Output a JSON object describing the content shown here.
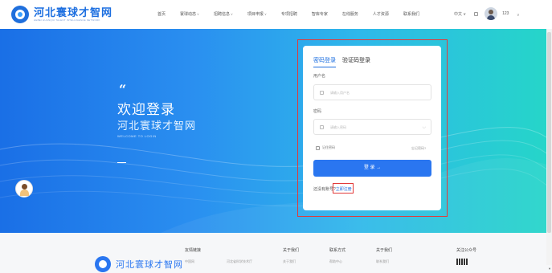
{
  "header": {
    "logo_name": "河北寰球才智网",
    "logo_sub": "HEBEI HUANQIU TALENT INTELLIGENCE NETWORK",
    "nav": [
      {
        "label": "首页",
        "has_menu": false
      },
      {
        "label": "寰球动态",
        "has_menu": true
      },
      {
        "label": "招聘信息",
        "has_menu": true
      },
      {
        "label": "项目申报",
        "has_menu": true
      },
      {
        "label": "专项招聘",
        "has_menu": false
      },
      {
        "label": "智库专家",
        "has_menu": false
      },
      {
        "label": "在线服务",
        "has_menu": false
      },
      {
        "label": "人才资源",
        "has_menu": false
      },
      {
        "label": "联系我们",
        "has_menu": false
      }
    ],
    "lang": "中文",
    "user_name": "123"
  },
  "hero": {
    "quote_mark": "“",
    "welcome": "欢迎登录",
    "site_name": "河北寰球才智网",
    "welcome_en": "WELCOME TO LOGIN"
  },
  "login": {
    "tabs": [
      {
        "label": "密码登录",
        "active": true
      },
      {
        "label": "验证码登录",
        "active": false
      }
    ],
    "username_label": "用户名",
    "username_placeholder": "请输入用户名",
    "password_label": "密码",
    "password_placeholder": "请输入密码",
    "remember_label": "记住密码",
    "forgot_label": "忘记密码?",
    "submit_label": "登 录",
    "register_prefix": "还没有账号?",
    "register_link": "立即注册"
  },
  "footer": {
    "logo_name": "河北寰球才智网",
    "columns": [
      {
        "title": "友情链接",
        "item": "中国网"
      },
      {
        "title": "关于我们",
        "item": "关于我们"
      },
      {
        "title": "联系方式",
        "item": "帮助中心"
      },
      {
        "title": "关于我们",
        "item": "联系我们"
      },
      {
        "title": "关注公众号",
        "item": ""
      }
    ],
    "extra_item": "河北省科学技术厅"
  },
  "colors": {
    "brand": "#1d6fe0",
    "button": "#2a76f0",
    "highlight": "#e23a3a"
  }
}
